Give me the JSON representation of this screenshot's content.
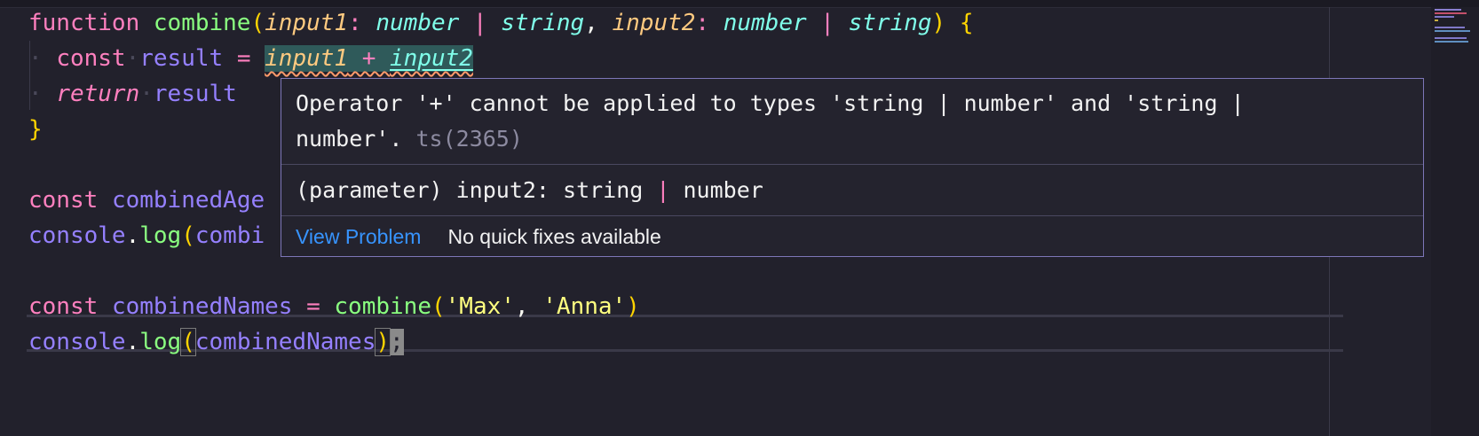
{
  "code": {
    "l1": {
      "kw_function": "function",
      "fn_name": "combine",
      "paren_open": "(",
      "p1": "input1",
      "colon1": ": ",
      "t1a": "number",
      "pipe1": " | ",
      "t1b": "string",
      "comma1": ", ",
      "p2": "input2",
      "colon2": ": ",
      "t2a": "number",
      "pipe2": " | ",
      "t2b": "string",
      "paren_close": ")",
      "brace_open": "{"
    },
    "l2": {
      "kw_const": "const",
      "var_result": "result",
      "eq": " = ",
      "sel_input1": "input1",
      "plus": " + ",
      "sel_input2": "input2"
    },
    "l3": {
      "kw_return": "return",
      "var_result": "result"
    },
    "l4": {
      "brace_close": "}"
    },
    "l6": {
      "kw_const": "const",
      "var_name": "combinedAge"
    },
    "l7": {
      "obj": "console",
      "dot": ".",
      "method": "log",
      "paren": "(",
      "arg": "combi"
    },
    "l9": {
      "kw_const": "const",
      "var_name": "combinedNames",
      "eq": " = ",
      "fn_name": "combine",
      "paren_open": "(",
      "s1": "'Max'",
      "comma": ", ",
      "s2": "'Anna'",
      "paren_close": ")"
    },
    "l10": {
      "obj": "console",
      "dot": ".",
      "method": "log",
      "paren_open": "(",
      "arg": "combinedNames",
      "paren_close": ")",
      "semi": ";"
    }
  },
  "hover": {
    "message_line1": "Operator '+' cannot be applied to types 'string | number' and 'string |",
    "message_line2": "number'.",
    "error_code": "ts(2365)",
    "sig_prefix": "(parameter) input2: string",
    "sig_pipe": " | ",
    "sig_suffix": "number",
    "view_problem": "View Problem",
    "no_quick_fixes": "No quick fixes available"
  },
  "colors": {
    "background": "#22212c",
    "keyword": "#ff80bf",
    "function": "#8aff80",
    "parameter": "#ffca80",
    "type": "#80ffea",
    "variable": "#9580ff",
    "string": "#ffff80",
    "link": "#3794ff",
    "hover_border": "#7d76b8"
  }
}
